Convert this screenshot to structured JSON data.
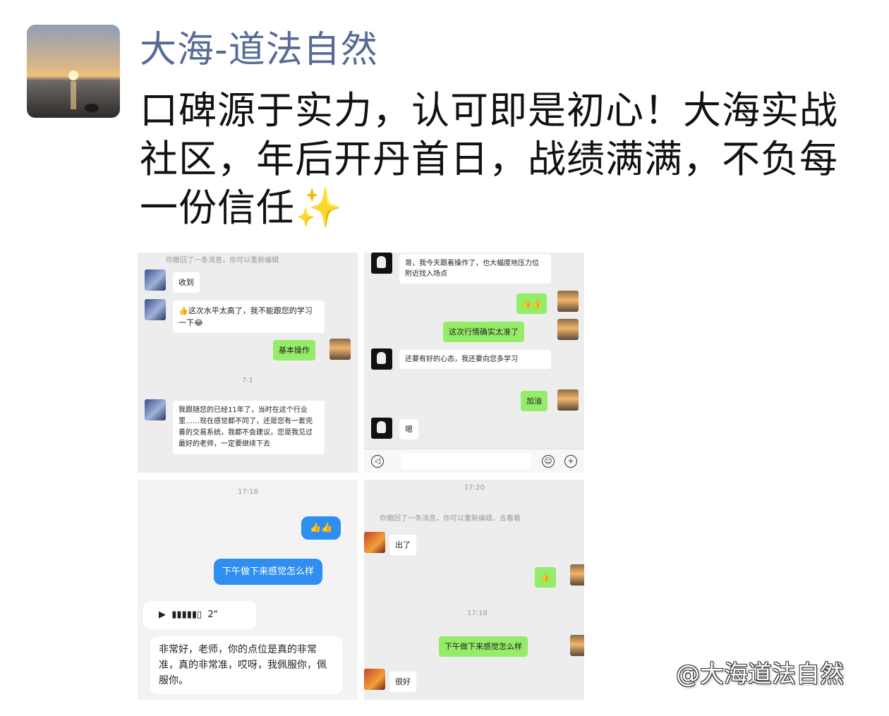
{
  "post": {
    "author": "大海-道法自然",
    "text": "口碑源于实力，认可即是初心！大海实战社区，年后开丹首日，战绩满满，不负每一份信任",
    "emoji": "✨"
  },
  "screenshots": {
    "s1": {
      "system_note": "你撤回了一条消息，你可以重新编辑",
      "msg1": "收到",
      "msg2": "👍这次水平太高了，我不能跟您的学习一下😂",
      "msg3": "基本操作",
      "time": "7:1",
      "msg4": "我跟随您的已经11年了，当时在这个行业里……现在感觉都不同了，还是您有一套完善的交易系统，我都不会建议，您是我见过最好的老师，一定要继续下去"
    },
    "s2": {
      "msg1": "哥，我今天跟着操作了，也大幅度地压力位附近找入场点",
      "msg2": "👍👍",
      "msg3": "这次行情确实太准了",
      "msg4": "还要有好的心态，我还要向您多学习",
      "msg5": "加油",
      "msg6": "嗯"
    },
    "s3": {
      "time": "17:18",
      "msg1": "👍👍",
      "msg2": "下午做下来感觉怎么样",
      "voice": "2\"",
      "msg3": "非常好，老师，你的点位是真的非常准，真的非常准，哎呀，我佩服你，佩服你。"
    },
    "s4": {
      "time": "17:20",
      "system_note": "你撤回了一条消息，你可以重新编辑，去看看",
      "msg1": "出了",
      "msg2": "👍",
      "time2": "17:18",
      "msg3": "下午做下来感觉怎么样",
      "msg4": "很好"
    }
  },
  "watermark": "@大海道法自然",
  "colors": {
    "author": "#576b95",
    "wechat_green": "#95ec69",
    "bubble_blue": "#2f8ff0"
  }
}
